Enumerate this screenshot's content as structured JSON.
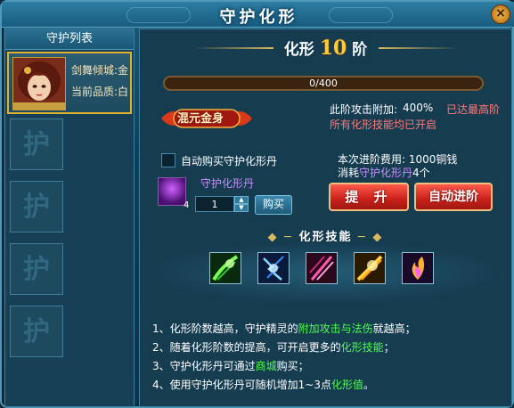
{
  "window": {
    "title": "守护化形",
    "close_label": "×"
  },
  "left_panel": {
    "header": "守护列表",
    "guard": {
      "name": "剑舞倾城:金",
      "quality": "当前品质:白"
    },
    "empty_slot_glyph": "护"
  },
  "stage": {
    "prefix": "化形",
    "level": "10",
    "suffix": "阶"
  },
  "progress": {
    "text": "0/400",
    "current": 0,
    "max": 400
  },
  "emblem": {
    "text": "混元金身"
  },
  "bonus": {
    "label": "此阶攻击附加:",
    "value": "400%",
    "max_status": "已达最高阶",
    "all_open": "所有化形技能均已开启"
  },
  "auto_buy": {
    "label": "自动购买守护化形丹",
    "checked": false
  },
  "cost": {
    "line1": "本次进阶费用: 1000铜钱",
    "consume_prefix": "消耗",
    "consume_item": "守护化形丹",
    "consume_suffix": "4个"
  },
  "item": {
    "name": "守护化形丹",
    "count": "4",
    "quantity": "1",
    "buy_label": "购买"
  },
  "buttons": {
    "upgrade": "提 升",
    "auto_upgrade": "自动进阶"
  },
  "skills": {
    "header": "化形技能",
    "icons": [
      "green-swirl-skill-icon",
      "blue-lightning-skill-icon",
      "pink-slash-skill-icon",
      "gold-strike-skill-icon",
      "purple-flame-skill-icon"
    ]
  },
  "tips": [
    {
      "a": "1、化形阶数越高，守护精灵的",
      "hl": "附加攻击与法伤",
      "b": "就越高；"
    },
    {
      "a": "2、随着化形阶数的提高，可开启更多的",
      "hl": "化形技能",
      "b": "；"
    },
    {
      "a": "3、守护化形丹可通过",
      "hl": "商城",
      "b": "购买；"
    },
    {
      "a": "4、使用守护化形丹可随机增加1~3点",
      "hl": "化形值",
      "b": "。"
    }
  ],
  "colors": {
    "accent_gold": "#ffcc33",
    "red_status": "#ff7a7a",
    "purple_item": "#c98cff",
    "green_highlight": "#4cff4c"
  }
}
